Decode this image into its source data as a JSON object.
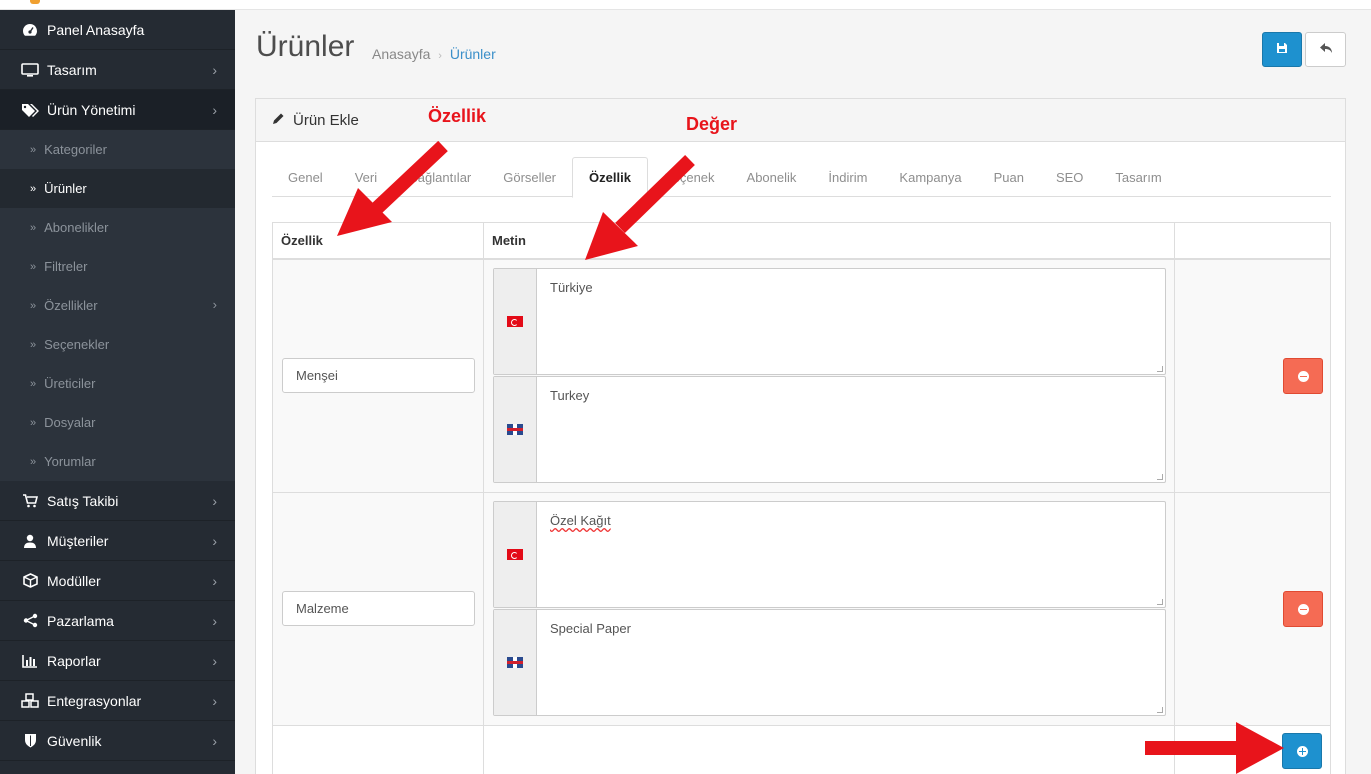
{
  "sidebar": {
    "items": [
      {
        "label": "Panel Anasayfa",
        "icon": "dashboard-icon",
        "chevron": false
      },
      {
        "label": "Tasarım",
        "icon": "monitor-icon",
        "chevron": true
      },
      {
        "label": "Ürün Yönetimi",
        "icon": "tags-icon",
        "chevron": true,
        "active": true
      }
    ],
    "subitems": [
      {
        "label": "Kategoriler"
      },
      {
        "label": "Ürünler",
        "active": true
      },
      {
        "label": "Abonelikler"
      },
      {
        "label": "Filtreler"
      },
      {
        "label": "Özellikler",
        "chevron": true
      },
      {
        "label": "Seçenekler"
      },
      {
        "label": "Üreticiler"
      },
      {
        "label": "Dosyalar"
      },
      {
        "label": "Yorumlar"
      }
    ],
    "bottom_items": [
      {
        "label": "Satış Takibi",
        "icon": "cart-icon"
      },
      {
        "label": "Müşteriler",
        "icon": "user-icon"
      },
      {
        "label": "Modüller",
        "icon": "cube-icon"
      },
      {
        "label": "Pazarlama",
        "icon": "share-icon"
      },
      {
        "label": "Raporlar",
        "icon": "bar-chart-icon"
      },
      {
        "label": "Entegrasyonlar",
        "icon": "cubes-icon"
      },
      {
        "label": "Güvenlik",
        "icon": "shield-icon"
      }
    ]
  },
  "header": {
    "title": "Ürünler",
    "breadcrumb": [
      "Anasayfa",
      "Ürünler"
    ]
  },
  "panel": {
    "title": "Ürün Ekle",
    "tabs": [
      "Genel",
      "Veri",
      "Bağlantılar",
      "Görseller",
      "Özellik",
      "Seçenek",
      "Abonelik",
      "İndirim",
      "Kampanya",
      "Puan",
      "SEO",
      "Tasarım"
    ],
    "active_tab": "Özellik"
  },
  "table": {
    "headers": [
      "Özellik",
      "Metin",
      ""
    ],
    "rows": [
      {
        "name": "Menşei",
        "values": [
          {
            "lang": "tr",
            "text": "Türkiye"
          },
          {
            "lang": "en",
            "text": "Turkey"
          }
        ]
      },
      {
        "name": "Malzeme",
        "values": [
          {
            "lang": "tr",
            "text": "Özel Kağıt"
          },
          {
            "lang": "en",
            "text": "Special Paper"
          }
        ]
      }
    ]
  },
  "annotations": {
    "label1": "Özellik",
    "label2": "Değer",
    "color": "#e8141b"
  },
  "colors": {
    "sidebar_bg": "#252b33",
    "primary": "#1e91cf",
    "danger": "#f56b54"
  }
}
